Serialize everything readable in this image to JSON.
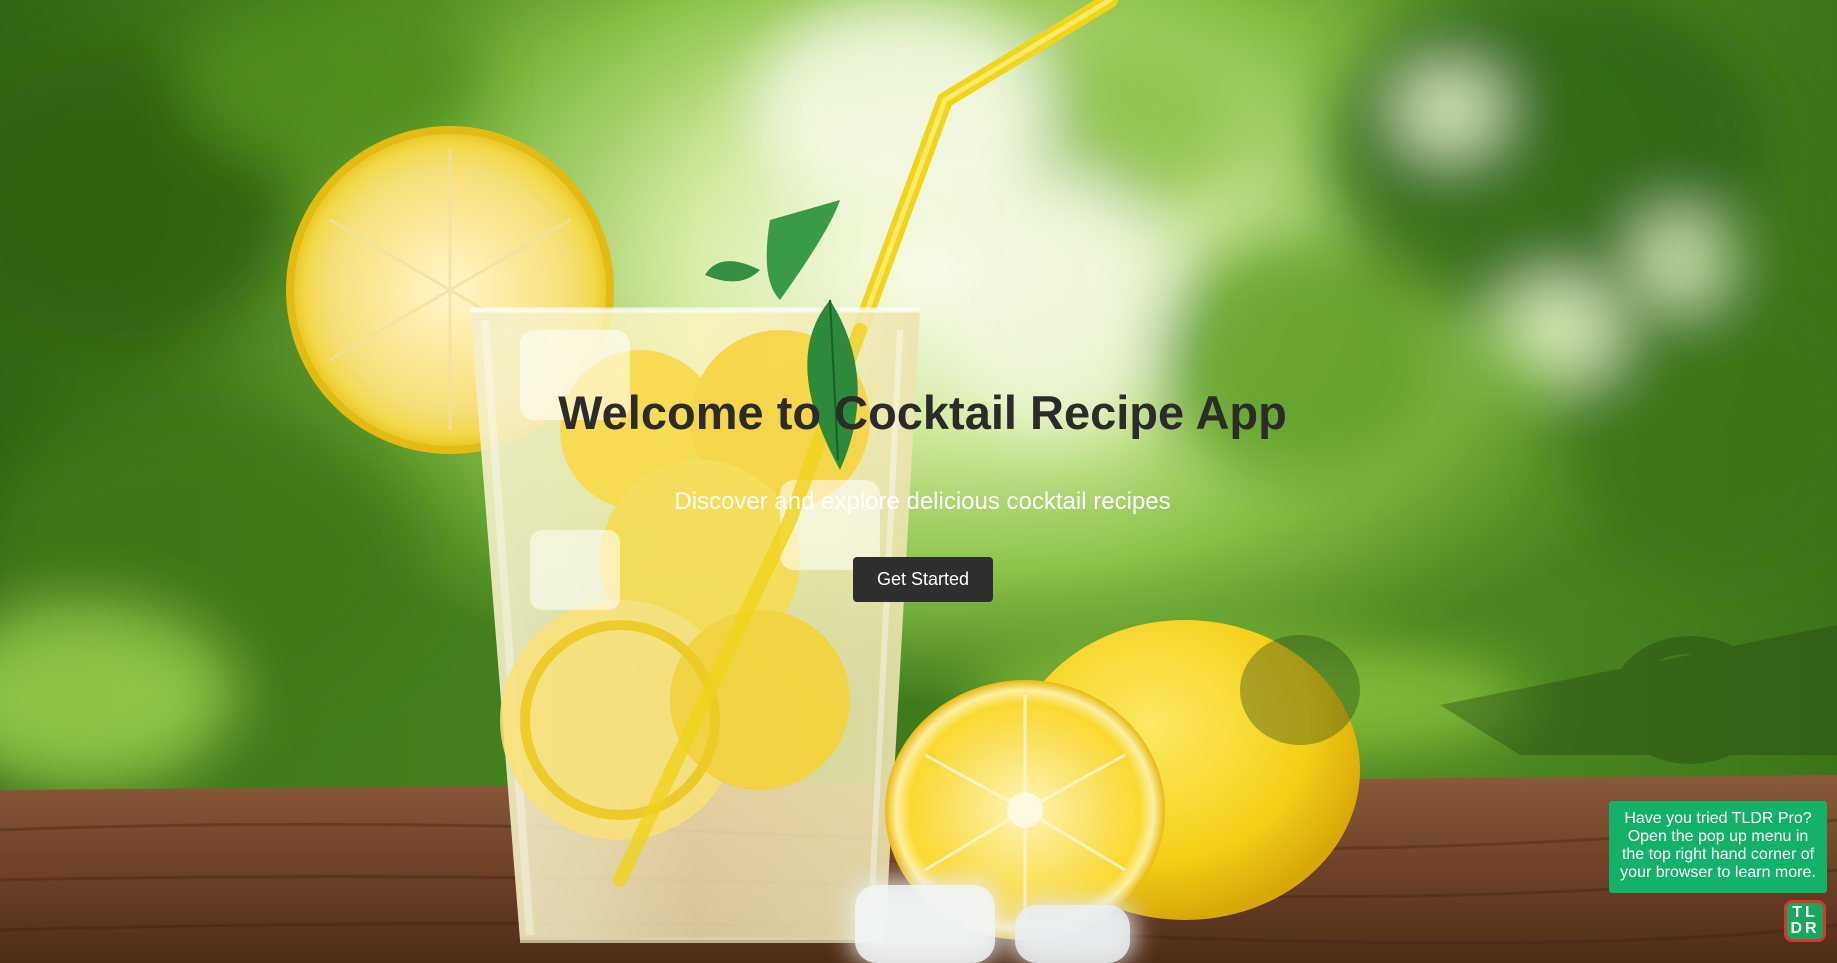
{
  "hero": {
    "title": "Welcome to Cocktail Recipe App",
    "subtitle": "Discover and explore delicious cocktail recipes",
    "cta_label": "Get Started"
  },
  "background": {
    "description_icon": "lemonade-photo",
    "colors": {
      "foliage_dark": "#3f7a1c",
      "foliage_light": "#a8d95c",
      "highlight": "#f4f8e6",
      "table": "#7a4a2c",
      "lemon": "#f6d52a",
      "title_text": "#2b2b2b"
    }
  },
  "tldr": {
    "popup_text": "Have you tried TLDR Pro? Open the pop up menu in the top right hand corner of your browser to learn more.",
    "logo_row1": "TL",
    "logo_row2": "DR",
    "colors": {
      "popup_bg": "#14b16a",
      "logo_border": "#d8362f"
    }
  }
}
